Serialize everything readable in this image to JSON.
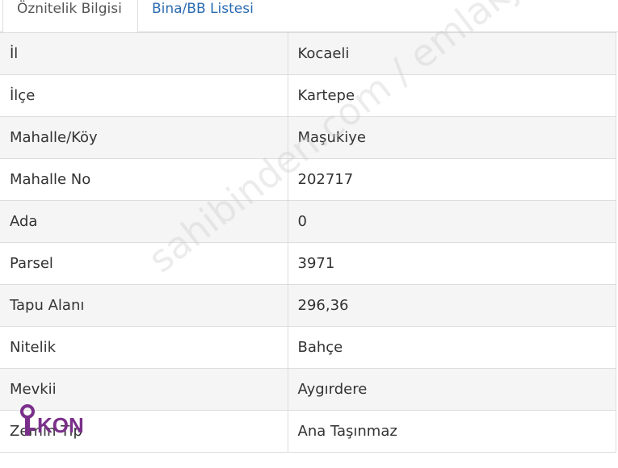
{
  "tabs": [
    {
      "label": "Öznitelik Bilgisi",
      "active": true
    },
    {
      "label": "Bina/BB Listesi",
      "active": false
    }
  ],
  "rows": [
    {
      "key": "İl",
      "value": "Kocaeli"
    },
    {
      "key": "İlçe",
      "value": "Kartepe"
    },
    {
      "key": "Mahalle/Köy",
      "value": "Maşukiye"
    },
    {
      "key": "Mahalle No",
      "value": "202717"
    },
    {
      "key": "Ada",
      "value": "0"
    },
    {
      "key": "Parsel",
      "value": "3971"
    },
    {
      "key": "Tapu Alanı",
      "value": "296,36"
    },
    {
      "key": "Nitelik",
      "value": "Bahçe"
    },
    {
      "key": "Mevkii",
      "value": "Aygırdere"
    },
    {
      "key": "Zemin Tip",
      "value": "Ana Taşınmaz"
    }
  ],
  "watermark": "sahibinden.com / emlakjet.com",
  "logo": {
    "text": "IKON",
    "color": "#7a2f8a"
  },
  "colors": {
    "link": "#2a6bb0",
    "border": "#dddddd",
    "stripe": "#f5f5f5"
  }
}
